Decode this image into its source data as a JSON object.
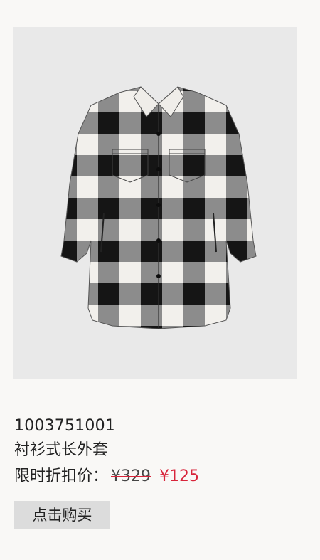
{
  "product": {
    "image_alt": "黑白格纹衬衫式长外套",
    "sku": "1003751001",
    "name": "衬衫式长外套",
    "price_label": "限时折扣价：",
    "original_price": "¥329",
    "sale_price": "¥125"
  },
  "actions": {
    "buy_label": "点击购买"
  },
  "colors": {
    "page_background": "#f9f8f6",
    "image_background": "#e9e9e9",
    "sale_red": "#d8243a",
    "button_background": "#dcdcdc"
  }
}
